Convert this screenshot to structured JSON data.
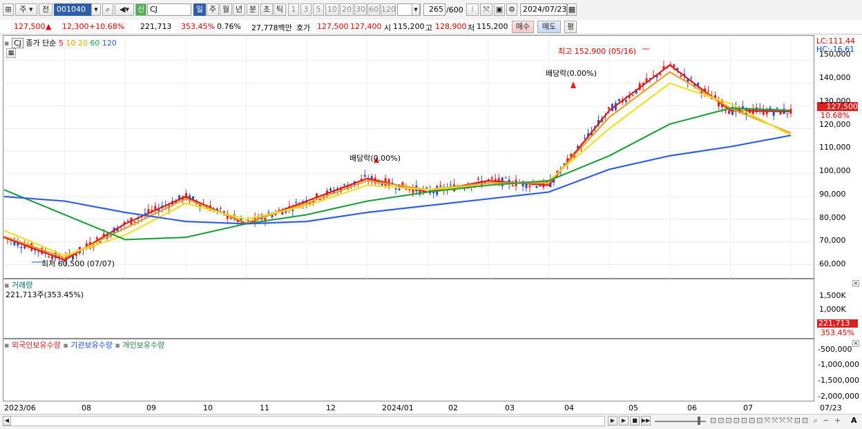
{
  "toolbar": {
    "market": "주",
    "prev_label": "전",
    "code": "001040",
    "search_mode": "신",
    "name": "CJ",
    "periods": [
      "일",
      "주",
      "월",
      "년",
      "분",
      "초",
      "틱"
    ],
    "intervals": [
      "1",
      "3",
      "5",
      "10",
      "20",
      "30",
      "60",
      "120"
    ],
    "count": "265",
    "count_total": "/600",
    "date": "2024/07/23"
  },
  "price": {
    "current": "127,500",
    "change_arrow": "▲",
    "change": "12,300",
    "change_pct": "+10.68%",
    "volume": "221,713",
    "volume_ratio": "353.45%",
    "turnover": "0.76%",
    "amount": "27,778백만",
    "ask_label": "호가",
    "ask": "127,500",
    "bid": "127,400",
    "open_label": "시",
    "open": "115,200",
    "high_label": "고",
    "high": "128,900",
    "low_label": "저",
    "low": "115,200",
    "buy_label": "매수",
    "sell_label": "매도",
    "eval_label": "평"
  },
  "main_chart": {
    "symbol": "CJ",
    "legend_title": "종가 단순",
    "ma": [
      {
        "period": "5",
        "color": "#e01818"
      },
      {
        "period": "10",
        "color": "#f0a020"
      },
      {
        "period": "20",
        "color": "#f0e020"
      },
      {
        "period": "60",
        "color": "#20a040"
      },
      {
        "period": "120",
        "color": "#3060e0"
      }
    ],
    "lc": "LC:111.44",
    "hc": "HC:-16.61",
    "max_label": "최고 152,900 (05/16)",
    "min_label": "최저 60,500 (07/07)",
    "dividend1": "배당락(0.00%)",
    "dividend2": "배당락(0.00%)",
    "price_tag": "127,500",
    "pct_tag": "10.68%",
    "y_ticks": [
      "150,000",
      "140,000",
      "130,000",
      "120,000",
      "110,000",
      "100,000",
      "90,000",
      "80,000",
      "70,000",
      "60,000"
    ]
  },
  "volume_chart": {
    "title": "거래량",
    "value": "221,713주(353.45%)",
    "y_ticks": [
      "1,500K",
      "1,000K",
      "500K"
    ],
    "tag": "221,713",
    "tag_pct": "353.45%"
  },
  "holdings_chart": {
    "legend": [
      "외국인보유수량",
      "기관보유수량",
      "개인보유수량"
    ],
    "y_ticks": [
      "-500,000",
      "-1,000,000",
      "-1,500,000",
      "-2,000,000"
    ]
  },
  "x_axis": [
    "2023/06",
    "08",
    "09",
    "10",
    "11",
    "12",
    "2024/01",
    "02",
    "03",
    "04",
    "05",
    "06",
    "07"
  ],
  "x_axis_end": "07/23",
  "chart_data": {
    "type": "line",
    "title": "",
    "x": [
      "2023/06",
      "08",
      "09",
      "10",
      "11",
      "12",
      "2024/01",
      "02",
      "03",
      "04",
      "05",
      "06",
      "07",
      "07/23"
    ],
    "series": [
      {
        "name": "5",
        "values": [
          72000,
          62000,
          78000,
          90000,
          78000,
          88000,
          98000,
          92000,
          97000,
          95000,
          128000,
          148000,
          128000,
          127500
        ]
      },
      {
        "name": "10",
        "values": [
          72500,
          63000,
          76000,
          89000,
          78500,
          87000,
          97000,
          93000,
          96000,
          96000,
          125000,
          145000,
          129000,
          118000
        ]
      },
      {
        "name": "20",
        "values": [
          75000,
          64000,
          73000,
          87000,
          80000,
          86000,
          95000,
          93000,
          95000,
          97000,
          120000,
          140000,
          131000,
          117000
        ]
      },
      {
        "name": "60",
        "values": [
          93000,
          82000,
          71000,
          72000,
          78000,
          82000,
          88000,
          92000,
          95000,
          97000,
          108000,
          122000,
          129000,
          128000
        ]
      },
      {
        "name": "120",
        "values": [
          90000,
          88000,
          83000,
          79000,
          78000,
          79000,
          83000,
          86000,
          89000,
          92000,
          102000,
          108000,
          112000,
          117000
        ]
      }
    ],
    "ylim": [
      55000,
      160000
    ]
  }
}
